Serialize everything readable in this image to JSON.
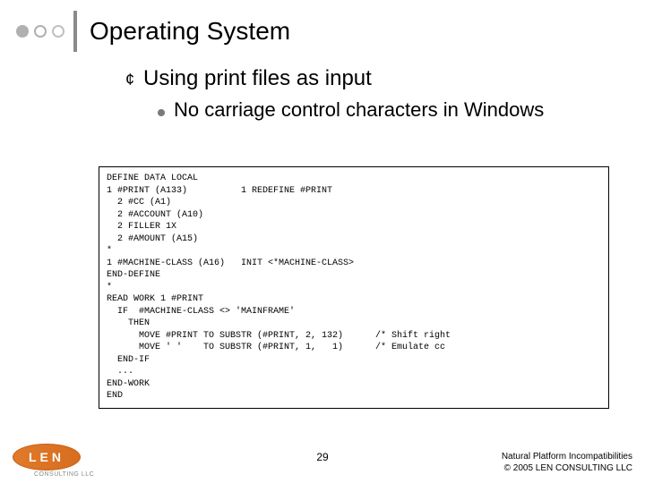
{
  "title": "Operating System",
  "bullets": {
    "level1": {
      "mark": "¢",
      "text": "Using print files as input"
    },
    "level2": {
      "text": "No carriage control characters in Windows"
    }
  },
  "code": "DEFINE DATA LOCAL\n1 #PRINT (A133)          1 REDEFINE #PRINT\n  2 #CC (A1)\n  2 #ACCOUNT (A10)\n  2 FILLER 1X\n  2 #AMOUNT (A15)\n*\n1 #MACHINE-CLASS (A16)   INIT <*MACHINE-CLASS>\nEND-DEFINE\n*\nREAD WORK 1 #PRINT\n  IF  #MACHINE-CLASS <> 'MAINFRAME'\n    THEN\n      MOVE #PRINT TO SUBSTR (#PRINT, 2, 132)      /* Shift right\n      MOVE ' '    TO SUBSTR (#PRINT, 1,   1)      /* Emulate cc\n  END-IF\n  ...\nEND-WORK\nEND",
  "page_number": "29",
  "footer": {
    "line1": "Natural Platform Incompatibilities",
    "line2": "© 2005 LEN CONSULTING LLC"
  },
  "logo": {
    "letters": "LEN",
    "sub": "CONSULTING LLC"
  }
}
